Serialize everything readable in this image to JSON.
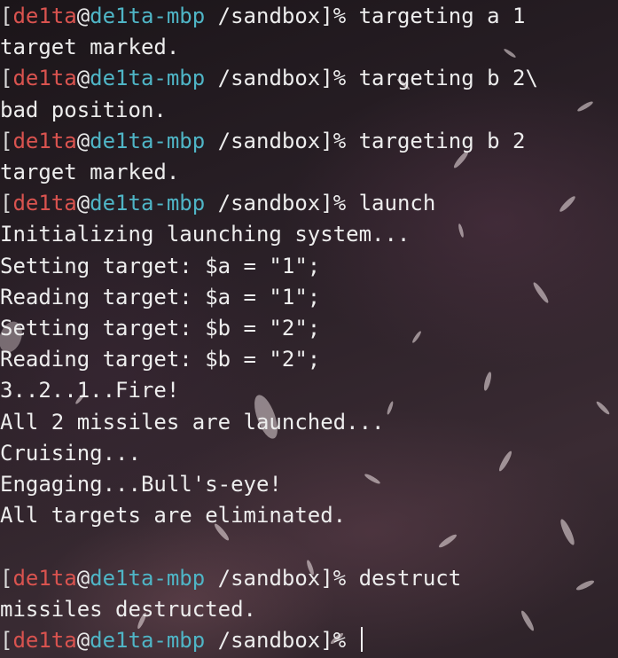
{
  "colors": {
    "user": "#d9534f",
    "host": "#4fb5c6",
    "text": "#ededed",
    "background": "#241d22"
  },
  "prompt": {
    "open_bracket": "[",
    "user": "de1ta",
    "at": "@",
    "host": "de1ta-mbp",
    "path": " /sandbox",
    "close": "]%"
  },
  "lines": [
    {
      "type": "prompt",
      "command": " targeting a 1"
    },
    {
      "type": "output",
      "text": "target marked."
    },
    {
      "type": "prompt",
      "command": " targeting b 2\\"
    },
    {
      "type": "output",
      "text": "bad position."
    },
    {
      "type": "prompt",
      "command": " targeting b 2"
    },
    {
      "type": "output",
      "text": "target marked."
    },
    {
      "type": "prompt",
      "command": " launch"
    },
    {
      "type": "output",
      "text": "Initializing launching system..."
    },
    {
      "type": "output",
      "text": "Setting target: $a = \"1\";"
    },
    {
      "type": "output",
      "text": "Reading target: $a = \"1\";"
    },
    {
      "type": "output",
      "text": "Setting target: $b = \"2\";"
    },
    {
      "type": "output",
      "text": "Reading target: $b = \"2\";"
    },
    {
      "type": "output",
      "text": "3..2..1..Fire!"
    },
    {
      "type": "output",
      "text": "All 2 missiles are launched..."
    },
    {
      "type": "output",
      "text": "Cruising..."
    },
    {
      "type": "output",
      "text": "Engaging...Bull's-eye!"
    },
    {
      "type": "output",
      "text": "All targets are eliminated."
    },
    {
      "type": "output",
      "text": ""
    },
    {
      "type": "prompt",
      "command": " destruct"
    },
    {
      "type": "output",
      "text": "missiles destructed."
    },
    {
      "type": "prompt",
      "command": " "
    }
  ]
}
